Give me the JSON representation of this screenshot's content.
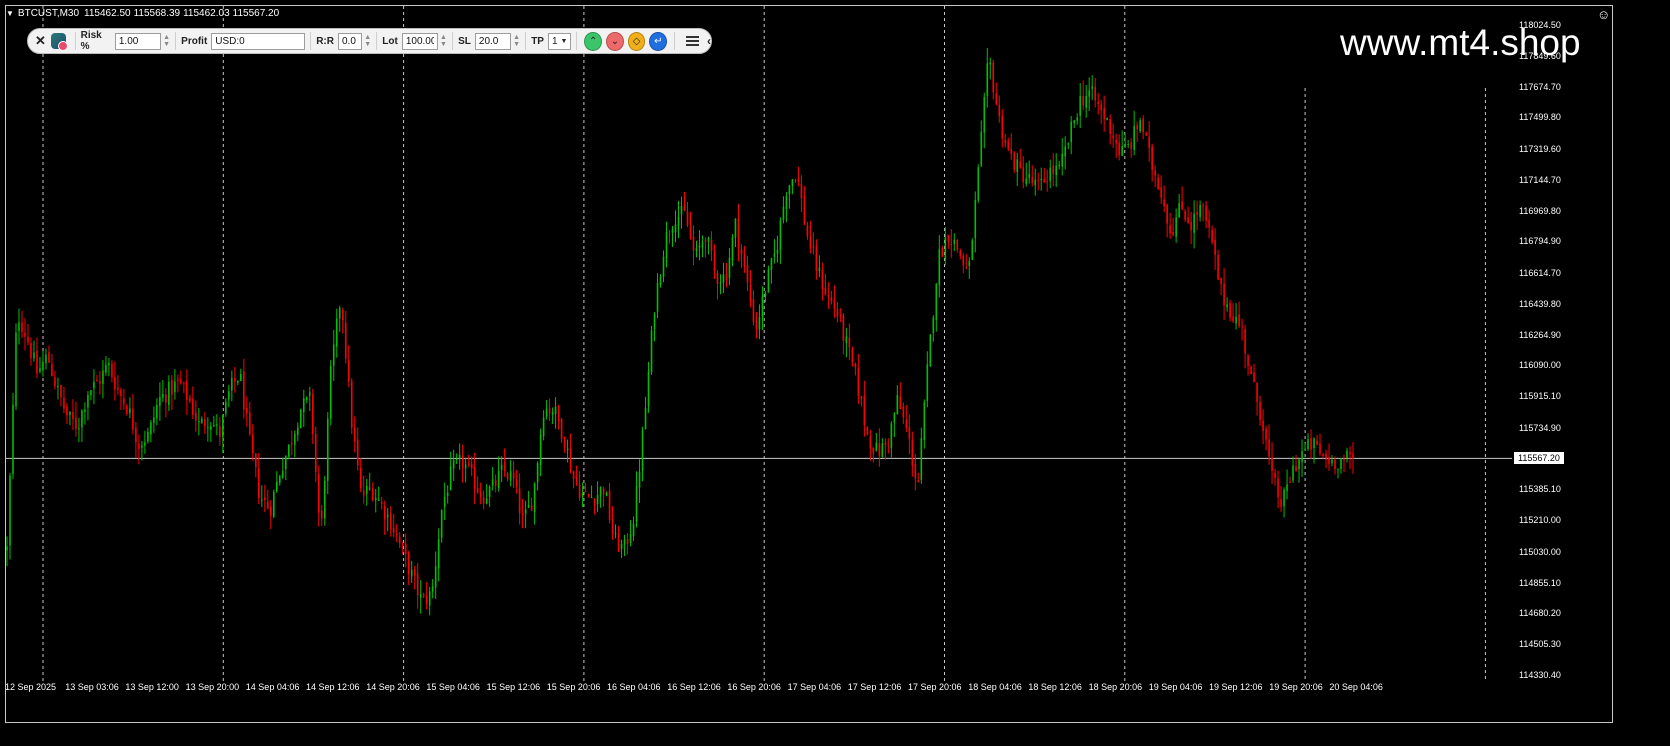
{
  "window": {
    "symbol": "BTCUST,M30",
    "ohlc": [
      "115462.50",
      "115568.39",
      "115462.03",
      "115567.20"
    ],
    "watermark": "www.mt4.shop"
  },
  "panel": {
    "risk_label": "Risk %",
    "risk_value": "1.00",
    "profit_label": "Profit",
    "profit_value": "USD:0",
    "rr_label": "R:R",
    "rr_value": "0.0",
    "lot_label": "Lot",
    "lot_value": "100.00",
    "sl_label": "SL",
    "sl_value": "20.0",
    "tp_label": "TP",
    "tp_value": "1",
    "buttons": [
      {
        "name": "buy-button",
        "icon": "chevron-up-icon",
        "color": "#3cc46b"
      },
      {
        "name": "sell-button",
        "icon": "chevron-down-icon",
        "color": "#ee6a6a"
      },
      {
        "name": "pending-button",
        "icon": "diamond-icon",
        "color": "#f1b01a"
      },
      {
        "name": "execute-button",
        "icon": "enter-icon",
        "color": "#1f6fe0"
      }
    ]
  },
  "colors": {
    "bull": "#00c000",
    "bear": "#ff0000",
    "grid": "#c8c8c8",
    "background": "#000000"
  },
  "chart_data": {
    "type": "candlestick",
    "timeframe": "M30",
    "price_ticks": [
      "118024.50",
      "117849.60",
      "117674.70",
      "117499.80",
      "117319.60",
      "117144.70",
      "116969.80",
      "116794.90",
      "116614.70",
      "116439.80",
      "116264.90",
      "116090.00",
      "115915.10",
      "115734.90",
      "115385.10",
      "115210.00",
      "115030.00",
      "114855.10",
      "114680.20",
      "114505.30",
      "114330.40"
    ],
    "price_tick_values": [
      118024.5,
      117849.6,
      117674.7,
      117499.8,
      117319.6,
      117144.7,
      116969.8,
      116794.9,
      116614.7,
      116439.8,
      116264.9,
      116090.0,
      115915.1,
      115734.9,
      115385.1,
      115210.0,
      115030.0,
      114855.1,
      114680.2,
      114505.3,
      114330.4
    ],
    "current_price": "115567.20",
    "current_price_value": 115567.2,
    "time_ticks": [
      "12 Sep 2025",
      "13 Sep 03:06",
      "13 Sep 12:00",
      "13 Sep 20:00",
      "14 Sep 04:06",
      "14 Sep 12:06",
      "14 Sep 20:06",
      "15 Sep 04:06",
      "15 Sep 12:06",
      "15 Sep 20:06",
      "16 Sep 04:06",
      "16 Sep 12:06",
      "16 Sep 20:06",
      "17 Sep 04:06",
      "17 Sep 12:06",
      "17 Sep 20:06",
      "18 Sep 04:06",
      "18 Sep 12:06",
      "18 Sep 20:06",
      "19 Sep 04:06",
      "19 Sep 12:06",
      "19 Sep 20:06",
      "20 Sep 04:06"
    ],
    "day_separators": [
      "13 Sep",
      "14 Sep",
      "15 Sep",
      "16 Sep",
      "17 Sep",
      "18 Sep",
      "19 Sep",
      "20 Sep",
      "21 Sep"
    ],
    "candle_count": 450,
    "path_closes": [
      115050,
      116400,
      116250,
      116050,
      116150,
      115950,
      115800,
      115750,
      115950,
      116000,
      116100,
      115950,
      115850,
      115650,
      115700,
      115900,
      115950,
      116000,
      115900,
      115750,
      115800,
      115700,
      115950,
      116050,
      115650,
      115350,
      115280,
      115500,
      115650,
      115850,
      115900,
      115100,
      116050,
      116500,
      115800,
      115350,
      115400,
      115300,
      115200,
      115050,
      114900,
      114750,
      114800,
      115300,
      115500,
      115550,
      115450,
      115350,
      115400,
      115500,
      115450,
      115200,
      115350,
      115850,
      115850,
      115700,
      115450,
      115350,
      115350,
      115400,
      115100,
      115050,
      115250,
      115800,
      116450,
      116800,
      116950,
      116950,
      116700,
      116850,
      116600,
      116600,
      116900,
      116600,
      116300,
      116550,
      116750,
      117100,
      117200,
      116850,
      116650,
      116500,
      116400,
      116200,
      116000,
      115700,
      115600,
      115650,
      115900,
      115700,
      115400,
      116100,
      116700,
      116850,
      116750,
      116600,
      117200,
      117850,
      117500,
      117300,
      117200,
      117150,
      117100,
      117200,
      117200,
      117400,
      117600,
      117650,
      117550,
      117450,
      117300,
      117350,
      117500,
      117250,
      117100,
      116850,
      117000,
      116900,
      117000,
      116800,
      116500,
      116400,
      116300,
      116000,
      115800,
      115450,
      115300,
      115500,
      115600,
      115650,
      115580,
      115550,
      115560,
      115567.2
    ]
  }
}
